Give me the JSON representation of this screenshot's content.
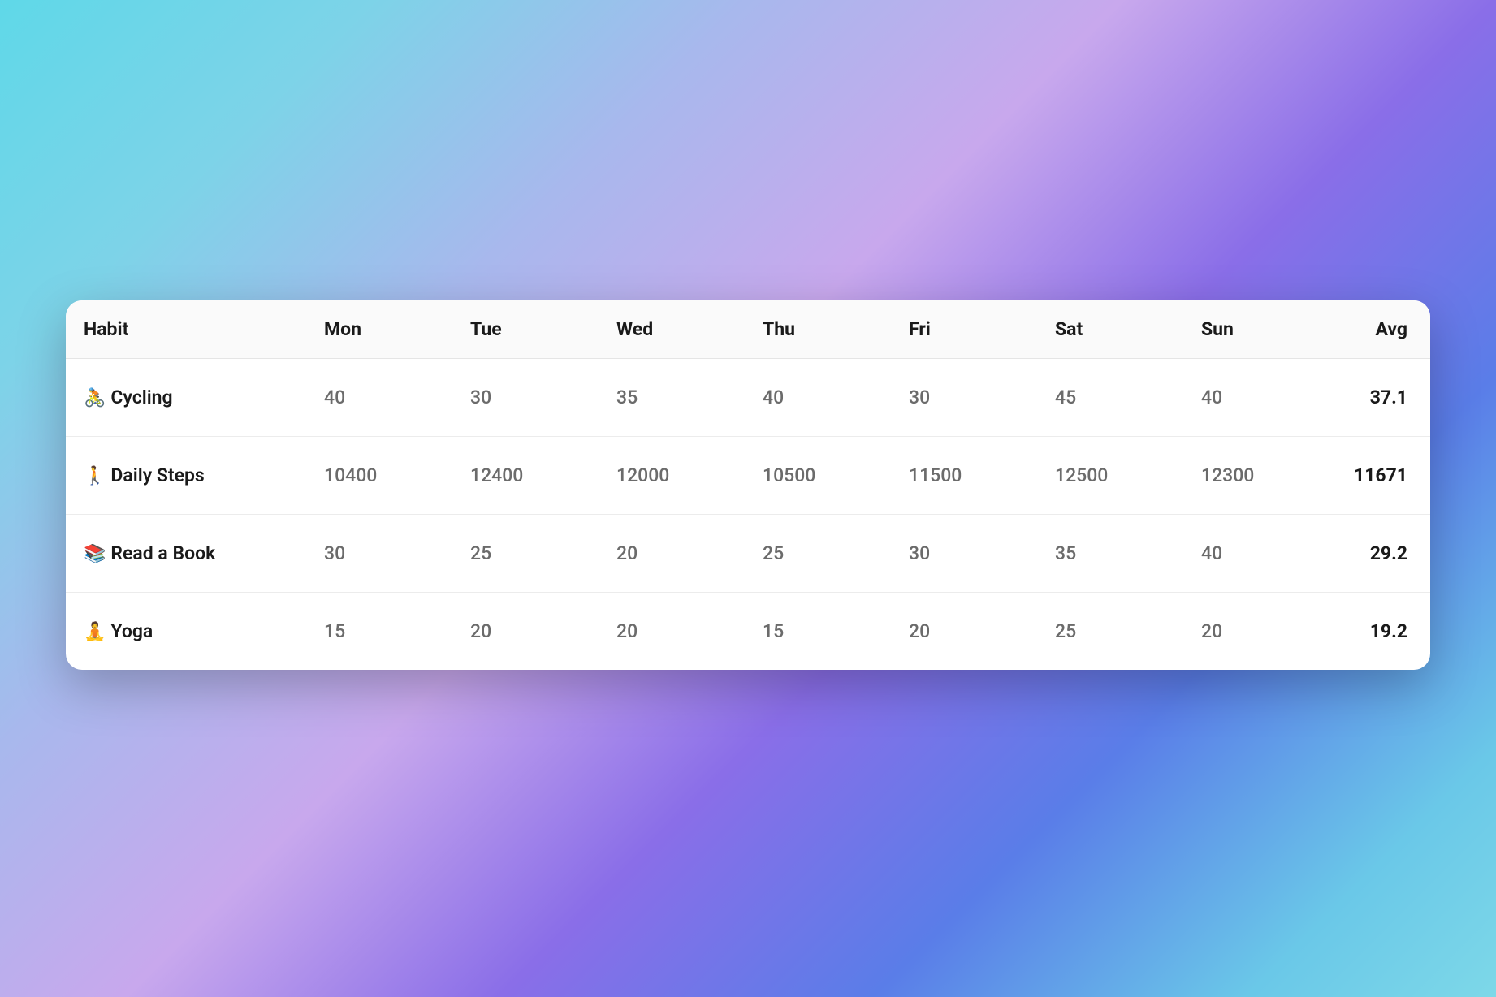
{
  "headers": {
    "habit": "Habit",
    "days": [
      "Mon",
      "Tue",
      "Wed",
      "Thu",
      "Fri",
      "Sat",
      "Sun"
    ],
    "avg": "Avg"
  },
  "rows": [
    {
      "icon": "🚴",
      "name": "Cycling",
      "values": [
        "40",
        "30",
        "35",
        "40",
        "30",
        "45",
        "40"
      ],
      "avg": "37.1"
    },
    {
      "icon": "🚶",
      "name": "Daily Steps",
      "values": [
        "10400",
        "12400",
        "12000",
        "10500",
        "11500",
        "12500",
        "12300"
      ],
      "avg": "11671"
    },
    {
      "icon": "📚",
      "name": "Read a Book",
      "values": [
        "30",
        "25",
        "20",
        "25",
        "30",
        "35",
        "40"
      ],
      "avg": "29.2"
    },
    {
      "icon": "🧘",
      "name": "Yoga",
      "values": [
        "15",
        "20",
        "20",
        "15",
        "20",
        "25",
        "20"
      ],
      "avg": "19.2"
    }
  ]
}
